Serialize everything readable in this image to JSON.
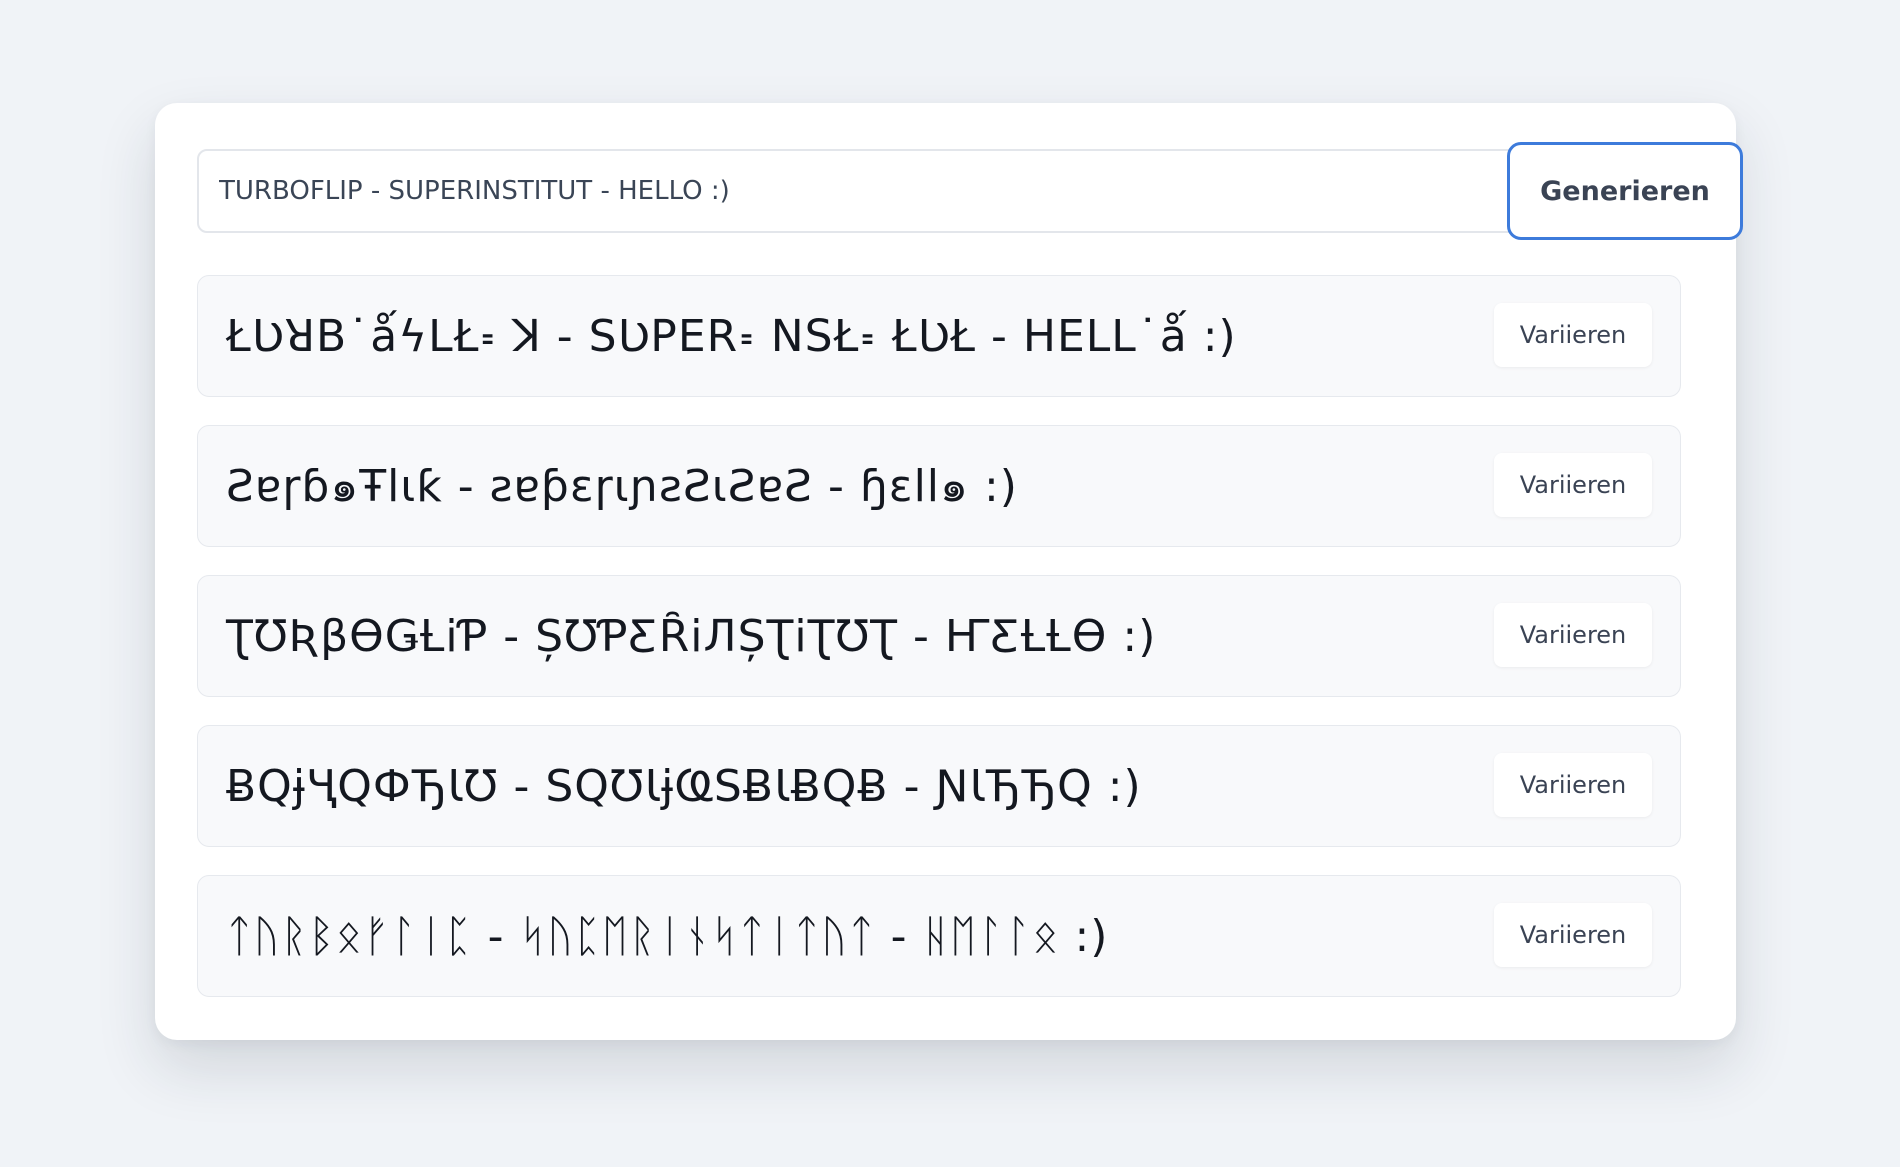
{
  "input": {
    "value": "TURBOFLIP - SUPERINSTITUT - HELLO :)"
  },
  "generate_button": {
    "label": "Generieren"
  },
  "results": [
    {
      "text": "ŁƲꓤꓐ˙ǻϟꓡŁ꞊ ꓘ - SƲꓑꓰꓣ꞊ ꓠꓢŁ꞊ ŁƲŁ - ꓧꓰꓡꓡ˙ǻ :)",
      "variate_label": "Variieren"
    },
    {
      "text": "Ƨɐɼɓ๑Ŧlɩƙ - ƨɐƥɛɼɩɲƨƧɩƧɐƧ - ɧɛll๑ :)",
      "variate_label": "Variieren"
    },
    {
      "text": "ƮƱƦβϴǤȽiƤ - ȘƱƤƸȒiЛȘƮiƮƱƮ - ҤƸȽȽϴ :)",
      "variate_label": "Variieren"
    },
    {
      "text": "ɃQɉҶQФЂƖƱ - ЅQƱƖɉҨЅɃƖɃQɃ - ƝƖЂЂQ :)",
      "variate_label": "Variieren"
    },
    {
      "text": "ᛏᚢᚱᛒᛟᚠᛚᛁᛈ - ᛋᚢᛈᛖᚱᛁᚾᛋᛏᛁᛏᚢᛏ - ᚺᛖᛚᛚᛟ :)",
      "variate_label": "Variieren"
    }
  ]
}
